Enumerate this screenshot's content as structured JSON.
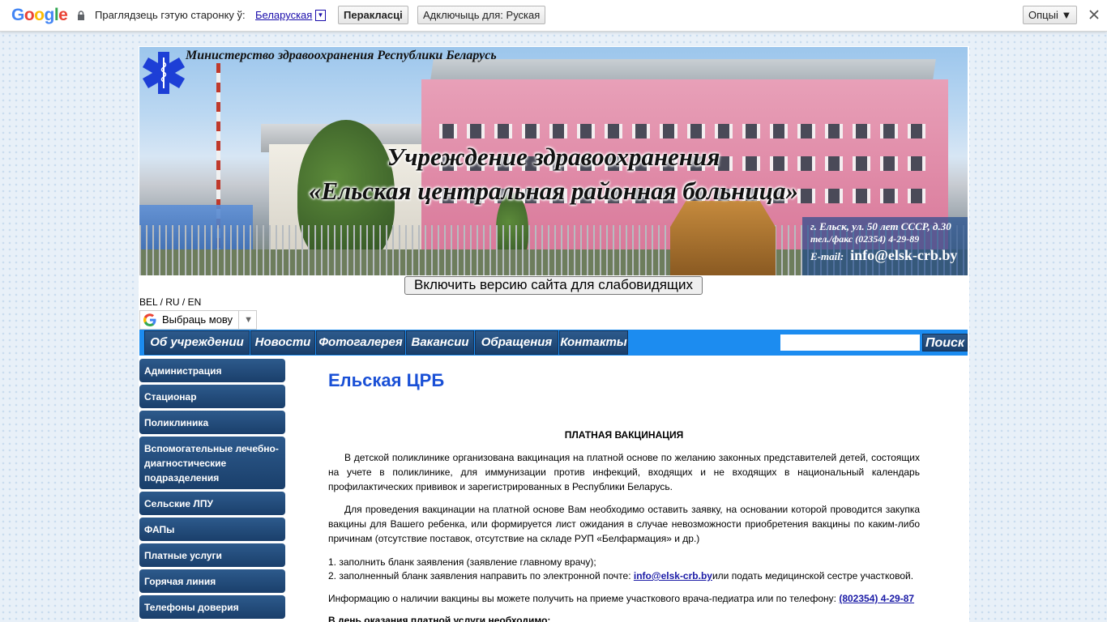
{
  "translate_bar": {
    "logo": "Google",
    "prompt": "Праглядзець гэтую старонку ў:",
    "language": "Беларуская",
    "translate_btn": "Перакласці",
    "disable_btn": "Адключыць для: Руская",
    "options_btn": "Опцыі ▼"
  },
  "header": {
    "ministry": "Министерство здравоохранения Республики Беларусь",
    "title_line1": "Учреждение здравоохранения",
    "title_line2": "«Ельская центральная районная больница»",
    "address": "г. Ельск, ул. 50 лет СССР, д.30",
    "phone": "тел./факс (02354) 4-29-89",
    "email_label": "E-mail:",
    "email": "info@elsk-crb.by"
  },
  "vision_button": "Включить версию сайта для слабовидящих",
  "langs": "BEL / RU / EN",
  "translate_select": "Выбраць мову",
  "nav": [
    "Об учреждении",
    "Новости",
    "Фотогалерея",
    "Вакансии",
    "Обращения",
    "Контакты"
  ],
  "search": {
    "button": "Поиск",
    "placeholder": ""
  },
  "sidebar": [
    "Администрация",
    "Стационар",
    "Поликлиника",
    "Вспомогательные лечебно-диагностические подразделения",
    "Сельские ЛПУ",
    "ФАПы",
    "Платные услуги",
    "Горячая линия",
    "Телефоны доверия"
  ],
  "content": {
    "title": "Ельская ЦРБ",
    "heading": "ПЛАТНАЯ ВАКЦИНАЦИЯ",
    "para1": "В детской поликлинике организована вакцинация на платной основе по желанию законных представителей детей, состоящих на учете в поликлинике, для иммунизации против инфекций, входящих и не входящих в национальный календарь профилактических прививок и зарегистрированных в Республики Беларусь.",
    "para2": "Для проведения вакцинации на платной основе Вам необходимо оставить заявку, на основании которой проводится закупка вакцины для Вашего ребенка, или формируется лист ожидания в случае невозможности приобретения вакцины по каким-либо причинам (отсутствие поставок, отсутствие на складе РУП «Белфармация» и др.)",
    "list1": "1. заполнить бланк заявления (заявление главному врачу);",
    "list2_pre": "2. заполненный бланк заявления направить по электронной почте: ",
    "list2_link": "info@elsk-crb.by",
    "list2_post": "или подать медицинской сестре участковой.",
    "info_pre": "Информацию о наличии вакцины вы можете получить на приеме участкового врача-педиатра или по телефону: ",
    "info_phone": "(802354) 4-29-87",
    "last": "В день оказания платной услуги необходимо:"
  }
}
